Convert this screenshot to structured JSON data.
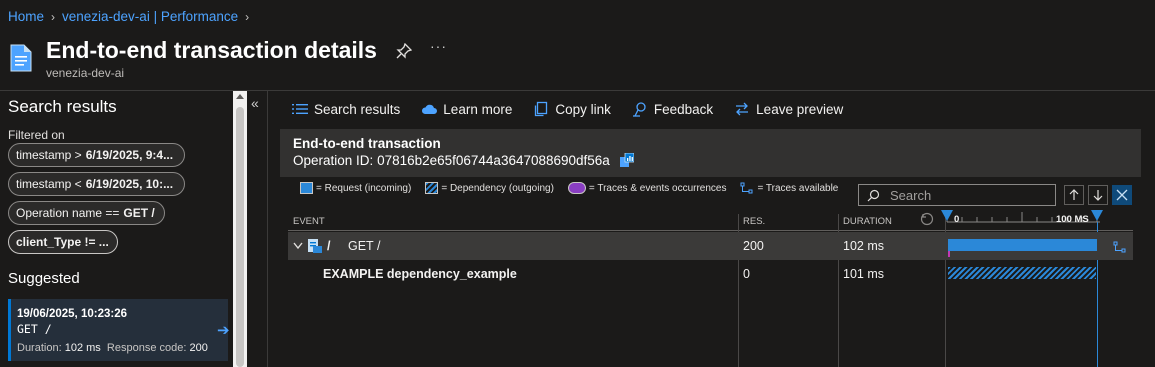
{
  "breadcrumb": [
    {
      "label": "Home"
    },
    {
      "label": "venezia-dev-ai | Performance"
    }
  ],
  "header": {
    "title": "End-to-end transaction details",
    "subtitle": "venezia-dev-ai",
    "more": "···"
  },
  "left": {
    "title": "Search results",
    "filtered_on": "Filtered on",
    "filters": [
      {
        "key": "timestamp >",
        "value": "6/19/2025, 9:4..."
      },
      {
        "key": "timestamp <",
        "value": "6/19/2025, 10:..."
      },
      {
        "key": "Operation name ==",
        "value": "GET /"
      },
      {
        "key": "client_Type != ...",
        "value": ""
      }
    ],
    "suggested_title": "Suggested",
    "suggested": {
      "timestamp": "19/06/2025, 10:23:26",
      "method": "GET /",
      "duration_label": "Duration:",
      "duration": "102 ms",
      "response_label": "Response code:",
      "response": "200"
    },
    "collapse": "«"
  },
  "toolbar": {
    "items": [
      {
        "label": "Search results",
        "icon": "list-icon"
      },
      {
        "label": "Learn more",
        "icon": "cloud-icon"
      },
      {
        "label": "Copy link",
        "icon": "copy-icon"
      },
      {
        "label": "Feedback",
        "icon": "feedback-icon"
      },
      {
        "label": "Leave preview",
        "icon": "switch-arrows-icon"
      }
    ]
  },
  "transaction": {
    "title": "End-to-end transaction",
    "operation_label": "Operation ID:",
    "operation_id": "07816b2e65f06744a3647088690df56a"
  },
  "legend": {
    "request": "= Request (incoming)",
    "dependency": "= Dependency (outgoing)",
    "traces": "= Traces & events occurrences",
    "available": "= Traces available"
  },
  "search": {
    "placeholder": "Search"
  },
  "grid": {
    "columns": {
      "event": "EVENT",
      "res": "RES.",
      "duration": "DURATION"
    },
    "timeline": {
      "start_label": "0",
      "end_label": "100 MS",
      "max_ms": 102
    },
    "rows": [
      {
        "name": "/",
        "method": "GET /",
        "res": "200",
        "duration": "102 ms",
        "start_ms": 0,
        "duration_ms": 102,
        "type": "request"
      },
      {
        "name": "EXAMPLE dependency_example",
        "res": "0",
        "duration": "101 ms",
        "start_ms": 0,
        "duration_ms": 101,
        "type": "dependency"
      }
    ]
  },
  "colors": {
    "accent": "#0078d4",
    "link": "#4da3ff",
    "request_bar": "#2b88d8",
    "trace": "#8a3ec2"
  }
}
